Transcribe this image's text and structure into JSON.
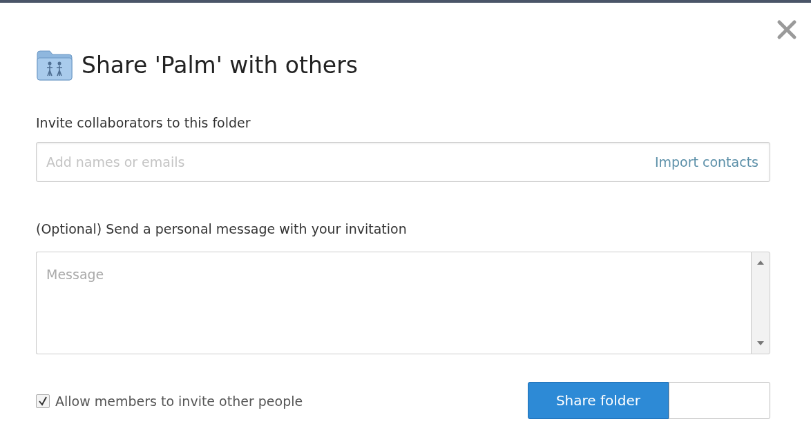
{
  "dialog": {
    "title": "Share 'Palm' with others",
    "invite": {
      "label": "Invite collaborators to this folder",
      "placeholder": "Add names or emails",
      "link": "Import contacts"
    },
    "message": {
      "label": "(Optional) Send a personal message with your invitation",
      "placeholder": "Message"
    },
    "allow_invite": {
      "label": "Allow members to invite other people",
      "checked": true
    },
    "buttons": [
      {
        "label": "Share folder",
        "kind": "primary"
      },
      {
        "kind": "secondary"
      }
    ]
  }
}
